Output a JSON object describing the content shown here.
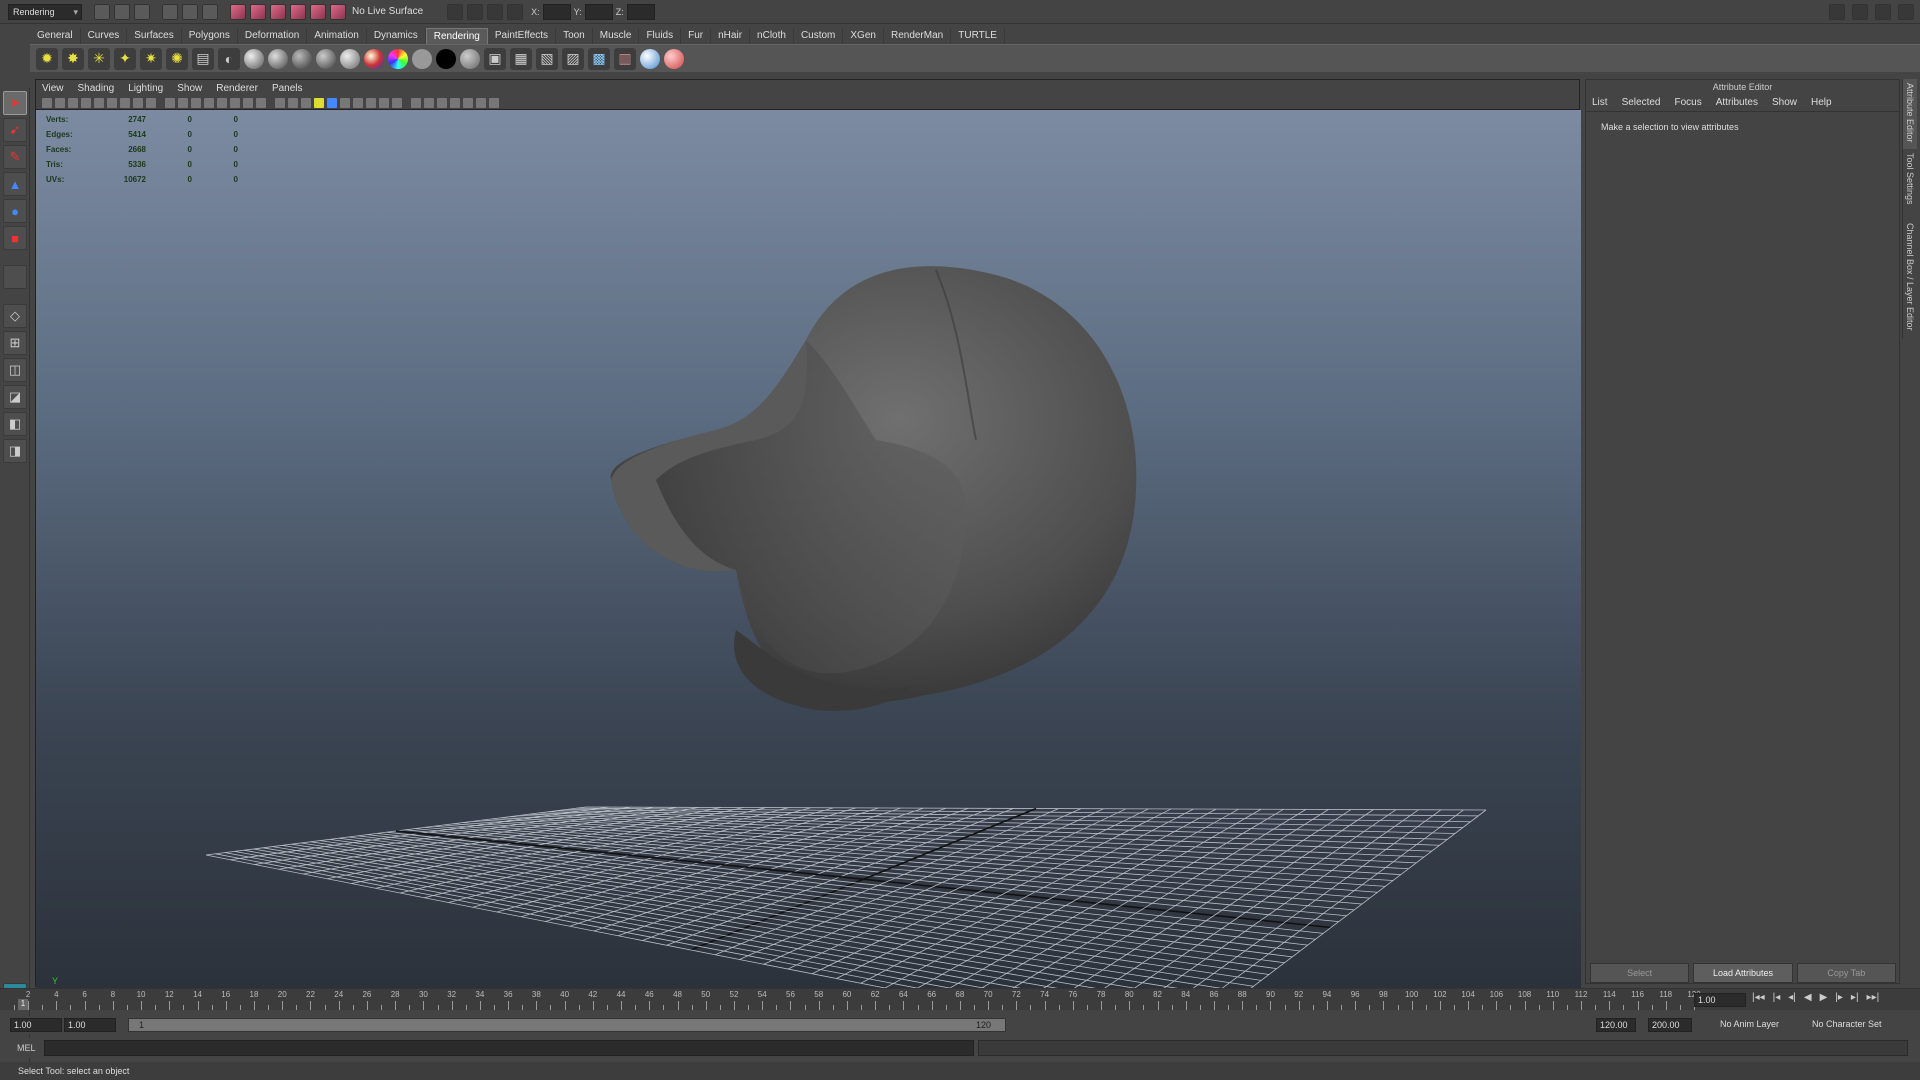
{
  "status_line": {
    "menu_set": "Rendering",
    "live_surface": "No Live Surface",
    "x_label": "X:",
    "y_label": "Y:",
    "z_label": "Z:"
  },
  "shelf_tabs": [
    "General",
    "Curves",
    "Surfaces",
    "Polygons",
    "Deformation",
    "Animation",
    "Dynamics",
    "Rendering",
    "PaintEffects",
    "Toon",
    "Muscle",
    "Fluids",
    "Fur",
    "nHair",
    "nCloth",
    "Custom",
    "XGen",
    "RenderMan",
    "TURTLE"
  ],
  "active_shelf_tab": "Rendering",
  "viewport": {
    "menu": [
      "View",
      "Shading",
      "Lighting",
      "Show",
      "Renderer",
      "Panels"
    ],
    "hud": [
      {
        "label": "Verts:",
        "total": "2747",
        "sel1": "0",
        "sel2": "0"
      },
      {
        "label": "Edges:",
        "total": "5414",
        "sel1": "0",
        "sel2": "0"
      },
      {
        "label": "Faces:",
        "total": "2668",
        "sel1": "0",
        "sel2": "0"
      },
      {
        "label": "Tris:",
        "total": "5336",
        "sel1": "0",
        "sel2": "0"
      },
      {
        "label": "UVs:",
        "total": "10672",
        "sel1": "0",
        "sel2": "0"
      }
    ],
    "axis_y": "Y",
    "axis_x": "x"
  },
  "attribute_editor": {
    "title": "Attribute Editor",
    "menu": [
      "List",
      "Selected",
      "Focus",
      "Attributes",
      "Show",
      "Help"
    ],
    "message": "Make a selection to view attributes",
    "buttons": {
      "select": "Select",
      "load": "Load Attributes",
      "copy": "Copy Tab"
    },
    "side_tabs": [
      "Attribute Editor",
      "Tool Settings",
      "Channel Box / Layer Editor"
    ]
  },
  "time_slider": {
    "labels": [
      "2",
      "4",
      "6",
      "8",
      "10",
      "12",
      "14",
      "16",
      "18",
      "20",
      "22",
      "24",
      "26",
      "28",
      "30",
      "32",
      "34",
      "36",
      "38",
      "40",
      "42",
      "44",
      "46",
      "48",
      "50",
      "52",
      "54",
      "56",
      "58",
      "60",
      "62",
      "64",
      "66",
      "68",
      "70",
      "72",
      "74",
      "76",
      "78",
      "80",
      "82",
      "84",
      "86",
      "88",
      "90",
      "92",
      "94",
      "96",
      "98",
      "100",
      "102",
      "104",
      "106",
      "108",
      "110",
      "112",
      "114",
      "116",
      "118",
      "120"
    ],
    "current_marker": "1",
    "current_frame": "1.00"
  },
  "range_slider": {
    "start": "1.00",
    "playback_start": "1.00",
    "range_start": "1",
    "range_end": "120",
    "playback_end": "120.00",
    "end": "200.00",
    "anim_layer": "No Anim Layer",
    "character_set": "No Character Set"
  },
  "command_line": {
    "tag": "MEL"
  },
  "help_line": "Select Tool: select an object"
}
